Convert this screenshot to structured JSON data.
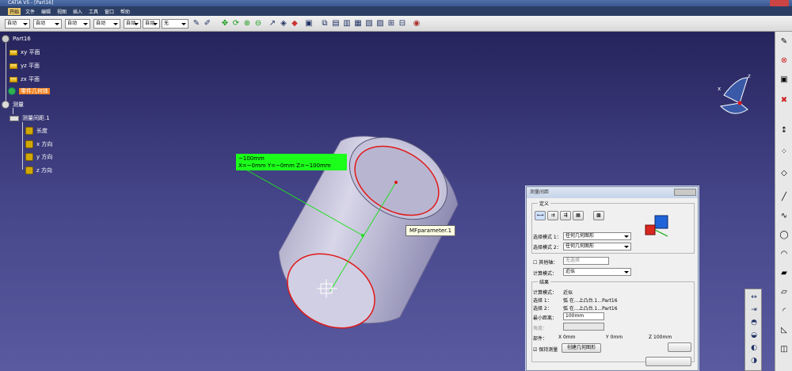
{
  "window": {
    "title": "CATIA V5 - [Part16]"
  },
  "menu": [
    "开始",
    "文件",
    "编辑",
    "视图",
    "插入",
    "工具",
    "窗口",
    "帮助"
  ],
  "toolbar": {
    "dropdowns": [
      "自动",
      "自动",
      "自动",
      "自动",
      "自动",
      "自动",
      "无"
    ]
  },
  "tree": {
    "root": "Part16",
    "planes": [
      "xy 平面",
      "yz 平面",
      "zx 平面"
    ],
    "body": "零件几何体",
    "measure": "测量",
    "measure_item": "测量间距.1",
    "measure_children": [
      "长度",
      "x 方向",
      "y 方向",
      "z 方向"
    ]
  },
  "labels": {
    "measure_line1": "~100mm",
    "measure_line2": "X=~0mm  Y=~0mm  Z=~100mm",
    "param": "MFparameter.1"
  },
  "compass": {
    "x_axis": "x",
    "z_axis": "z"
  },
  "dialog": {
    "title": "测量间距",
    "definition": "定义",
    "mode1_label": "选择模式 1：",
    "mode1_value": "任何几何图形",
    "mode2_label": "选择模式 2：",
    "mode2_value": "任何几何图形",
    "other_axis_label": "其他轴：",
    "other_axis_value": "无选择",
    "calc_mode_label": "计算模式：",
    "calc_mode_value": "近似",
    "result": "结果",
    "res_calc_label": "计算模式：",
    "res_calc_value": "近似",
    "sel1_label": "选择 1：",
    "sel1_value": "弧 在...上凸台.1...Part16",
    "sel2_label": "选择 2：",
    "sel2_value": "弧 在...上凸台.1...Part16",
    "min_dist_label": "最小距离：",
    "min_dist_value": "100mm",
    "angle_label": "角度：",
    "components_label": "部件：",
    "comp_x": "X 0mm",
    "comp_y": "Y 0mm",
    "comp_z": "Z 100mm",
    "keep_label": "保持测量",
    "create_geom_button": "创建几何图形"
  },
  "colors": {
    "viewport_top": "#26245c",
    "viewport_bottom": "#5a5aa0",
    "measure_label_bg": "#1bff1b",
    "edge_highlight": "#e01818",
    "measure_line": "#22dd22"
  }
}
